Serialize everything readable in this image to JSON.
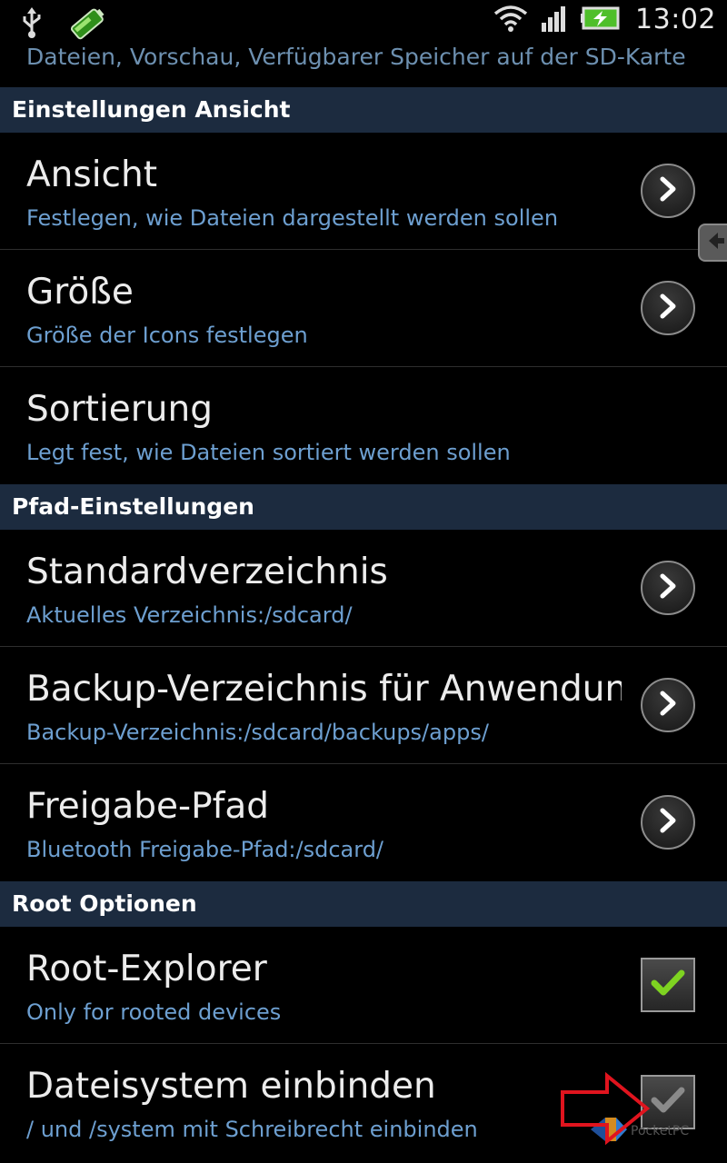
{
  "status_bar": {
    "time": "13:02",
    "icons": [
      "usb-icon",
      "battery-app-icon",
      "wifi-icon",
      "signal-icon",
      "battery-charging-icon"
    ]
  },
  "top_partial_text": "Dateien, Vorschau, Verfügbarer Speicher auf der SD-Karte",
  "sections": [
    {
      "header": "Einstellungen Ansicht",
      "items": [
        {
          "title": "Ansicht",
          "subtitle": "Festlegen, wie Dateien dargestellt werden sollen",
          "control": "arrow"
        },
        {
          "title": "Größe",
          "subtitle": "Größe der Icons festlegen",
          "control": "arrow"
        },
        {
          "title": "Sortierung",
          "subtitle": "Legt fest, wie Dateien sortiert werden sollen",
          "control": "none"
        }
      ]
    },
    {
      "header": "Pfad-Einstellungen",
      "items": [
        {
          "title": "Standardverzeichnis",
          "subtitle": "Aktuelles Verzeichnis:/sdcard/",
          "control": "arrow"
        },
        {
          "title": "Backup-Verzeichnis für Anwendungen",
          "subtitle": "Backup-Verzeichnis:/sdcard/backups/apps/",
          "control": "arrow"
        },
        {
          "title": "Freigabe-Pfad",
          "subtitle": "Bluetooth Freigabe-Pfad:/sdcard/",
          "control": "arrow"
        }
      ]
    },
    {
      "header": "Root Optionen",
      "items": [
        {
          "title": "Root-Explorer",
          "subtitle": "Only for rooted devices",
          "control": "checkbox",
          "checked": true,
          "enabled": true
        },
        {
          "title": "Dateisystem einbinden",
          "subtitle": "/ und /system mit Schreibrecht einbinden",
          "control": "checkbox",
          "checked": true,
          "enabled": false
        }
      ]
    }
  ],
  "colors": {
    "header_bg": "#1c2b3f",
    "subtitle": "#6d9fd0",
    "check_enabled": "#7ed321",
    "annotation_arrow": "#e0141e"
  },
  "watermark": "PocketPC"
}
